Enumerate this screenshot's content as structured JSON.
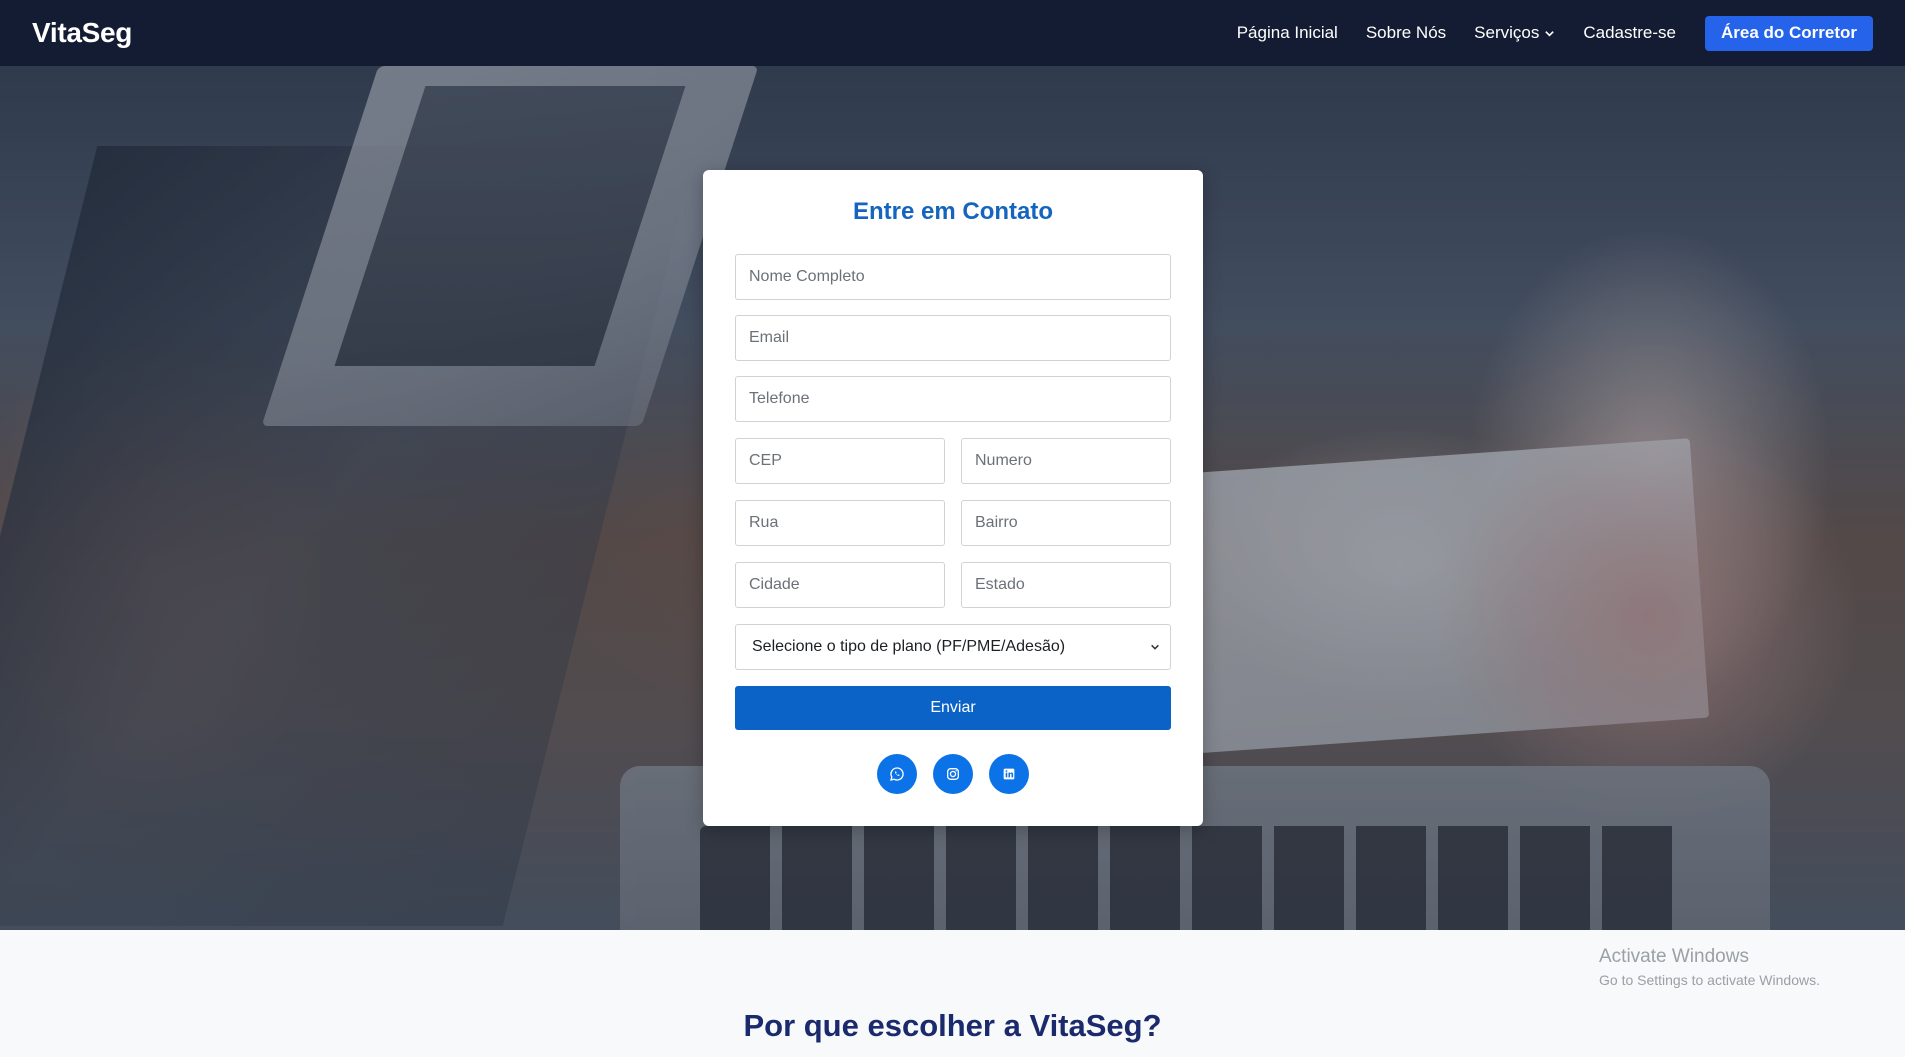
{
  "navbar": {
    "brand": "VitaSeg",
    "links": [
      "Página Inicial",
      "Sobre Nós",
      "Serviços",
      "Cadastre-se"
    ],
    "cta": "Área do Corretor"
  },
  "form": {
    "title": "Entre em Contato",
    "placeholders": {
      "nome": "Nome Completo",
      "email": "Email",
      "telefone": "Telefone",
      "cep": "CEP",
      "numero": "Numero",
      "rua": "Rua",
      "bairro": "Bairro",
      "cidade": "Cidade",
      "estado": "Estado"
    },
    "plan_select": "Selecione o tipo de plano (PF/PME/Adesão)",
    "submit": "Enviar",
    "socials": [
      "whatsapp-icon",
      "instagram-icon",
      "linkedin-icon"
    ]
  },
  "section": {
    "title": "Por que escolher a VitaSeg?"
  },
  "watermark": {
    "line1": "Activate Windows",
    "line2": "Go to Settings to activate Windows."
  },
  "colors": {
    "navbar_bg": "#141c33",
    "cta_bg": "#2563eb",
    "title_blue": "#1565c0",
    "submit_bg": "#0b63c7",
    "social_bg": "#0b72e7",
    "section_title": "#1a2a6c"
  }
}
